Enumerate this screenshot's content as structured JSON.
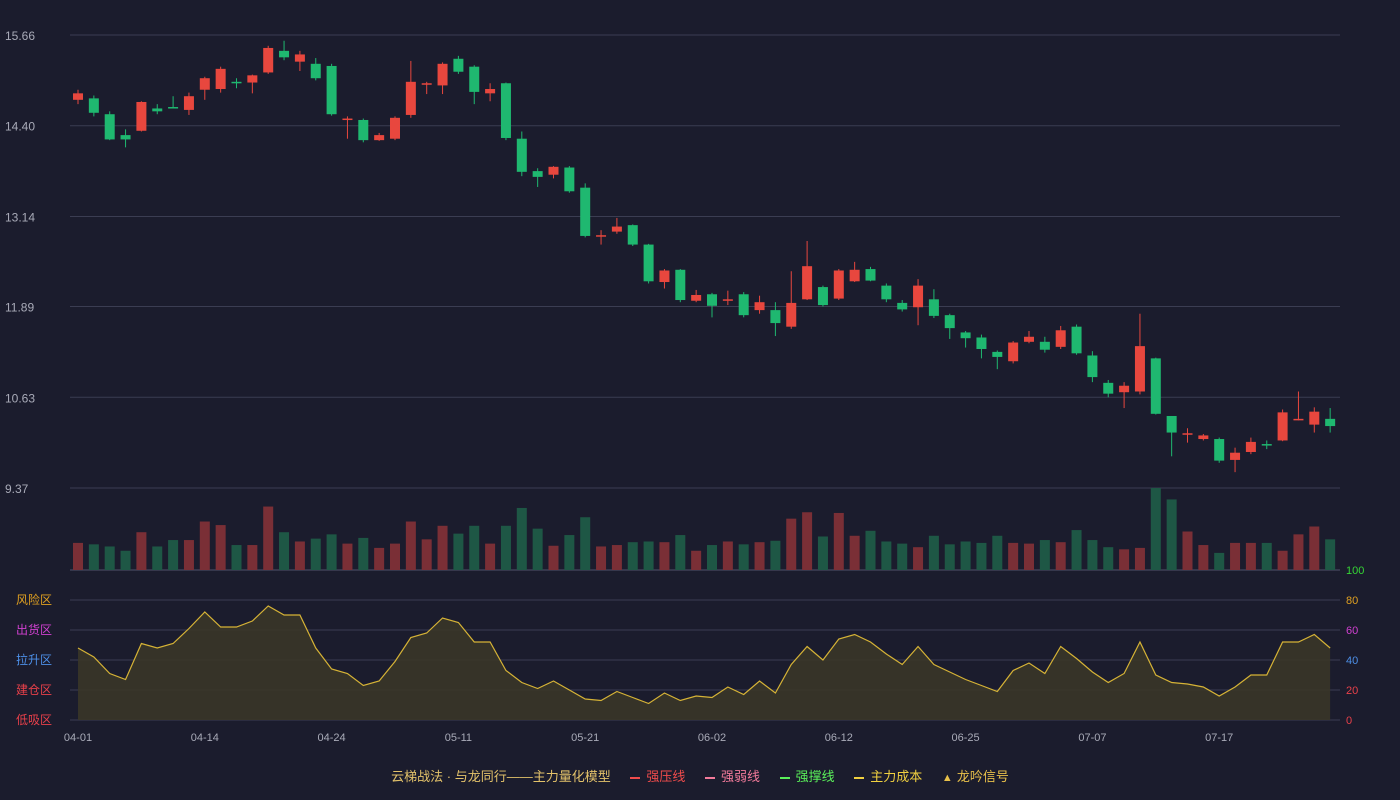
{
  "chart_data": {
    "type": "candlestick",
    "price_axis": {
      "ticks": [
        "15.66",
        "14.40",
        "13.14",
        "11.89",
        "10.63",
        "9.37"
      ],
      "range": [
        9.37,
        15.66
      ]
    },
    "oscillator_axis": {
      "right_ticks": [
        "100",
        "80",
        "60",
        "40",
        "20",
        "0"
      ],
      "right_tick_colors": [
        "#35d535",
        "#e0a020",
        "#d040d0",
        "#4d8fe8",
        "#e8404a",
        "#e8404a"
      ],
      "zones": [
        {
          "label": "风险区",
          "color": "#e0a020"
        },
        {
          "label": "出货区",
          "color": "#d040d0"
        },
        {
          "label": "拉升区",
          "color": "#4d8fe8"
        },
        {
          "label": "建仓区",
          "color": "#e8404a"
        },
        {
          "label": "低吸区",
          "color": "#e8404a"
        }
      ],
      "range": [
        0,
        100
      ]
    },
    "date_ticks": [
      {
        "i": 0,
        "label": "04-01"
      },
      {
        "i": 8,
        "label": "04-14"
      },
      {
        "i": 16,
        "label": "04-24"
      },
      {
        "i": 24,
        "label": "05-11"
      },
      {
        "i": 32,
        "label": "05-21"
      },
      {
        "i": 40,
        "label": "06-02"
      },
      {
        "i": 48,
        "label": "06-12"
      },
      {
        "i": 56,
        "label": "06-25"
      },
      {
        "i": 64,
        "label": "07-07"
      },
      {
        "i": 72,
        "label": "07-17"
      }
    ],
    "colors": {
      "up": "#e8473e",
      "down": "#1fb870",
      "vol_up": "#7a2f36",
      "vol_down": "#1e5745",
      "osc_line": "#d6b336",
      "osc_fill": "#3a3628"
    },
    "candles": [
      [
        14.76,
        14.85,
        14.9,
        14.7
      ],
      [
        14.78,
        14.58,
        14.82,
        14.53
      ],
      [
        14.56,
        14.21,
        14.6,
        14.2
      ],
      [
        14.27,
        14.21,
        14.35,
        14.1
      ],
      [
        14.33,
        14.73,
        14.74,
        14.32
      ],
      [
        14.64,
        14.6,
        14.7,
        14.56
      ],
      [
        14.66,
        14.65,
        14.81,
        14.64
      ],
      [
        14.62,
        14.81,
        14.86,
        14.55
      ],
      [
        14.9,
        15.06,
        15.08,
        14.76
      ],
      [
        14.91,
        15.19,
        15.22,
        14.86
      ],
      [
        15.01,
        14.99,
        15.06,
        14.92
      ],
      [
        15.0,
        15.1,
        15.11,
        14.85
      ],
      [
        15.14,
        15.48,
        15.51,
        15.12
      ],
      [
        15.44,
        15.35,
        15.58,
        15.31
      ],
      [
        15.29,
        15.39,
        15.44,
        15.16
      ],
      [
        15.26,
        15.06,
        15.34,
        15.03
      ],
      [
        15.23,
        14.56,
        15.26,
        14.54
      ],
      [
        14.48,
        14.5,
        14.53,
        14.22
      ],
      [
        14.48,
        14.2,
        14.5,
        14.17
      ],
      [
        14.2,
        14.27,
        14.3,
        14.19
      ],
      [
        14.22,
        14.51,
        14.53,
        14.2
      ],
      [
        14.55,
        15.01,
        15.3,
        14.51
      ],
      [
        14.98,
        14.99,
        15.01,
        14.84
      ],
      [
        14.96,
        15.26,
        15.28,
        14.84
      ],
      [
        15.33,
        15.15,
        15.37,
        15.12
      ],
      [
        15.22,
        14.87,
        15.24,
        14.7
      ],
      [
        14.85,
        14.91,
        14.99,
        14.74
      ],
      [
        14.99,
        14.23,
        15.0,
        14.2
      ],
      [
        14.22,
        13.76,
        14.32,
        13.7
      ],
      [
        13.77,
        13.69,
        13.81,
        13.55
      ],
      [
        13.72,
        13.83,
        13.84,
        13.67
      ],
      [
        13.82,
        13.49,
        13.84,
        13.47
      ],
      [
        13.54,
        12.87,
        13.6,
        12.85
      ],
      [
        12.87,
        12.88,
        12.95,
        12.75
      ],
      [
        12.93,
        13.0,
        13.12,
        12.9
      ],
      [
        13.02,
        12.75,
        13.03,
        12.73
      ],
      [
        12.75,
        12.24,
        12.76,
        12.21
      ],
      [
        12.23,
        12.39,
        12.41,
        12.14
      ],
      [
        12.4,
        11.98,
        12.41,
        11.95
      ],
      [
        11.97,
        12.05,
        12.12,
        11.95
      ],
      [
        12.06,
        11.9,
        12.08,
        11.74
      ],
      [
        11.98,
        11.99,
        12.11,
        11.91
      ],
      [
        12.06,
        11.77,
        12.09,
        11.74
      ],
      [
        11.84,
        11.95,
        12.04,
        11.79
      ],
      [
        11.84,
        11.66,
        11.95,
        11.48
      ],
      [
        11.61,
        11.94,
        12.38,
        11.58
      ],
      [
        11.99,
        12.45,
        12.8,
        11.98
      ],
      [
        12.16,
        11.91,
        12.18,
        11.89
      ],
      [
        12.0,
        12.39,
        12.41,
        11.98
      ],
      [
        12.24,
        12.4,
        12.51,
        12.23
      ],
      [
        12.41,
        12.25,
        12.44,
        12.24
      ],
      [
        12.18,
        11.99,
        12.21,
        11.95
      ],
      [
        11.94,
        11.85,
        11.98,
        11.82
      ],
      [
        11.88,
        12.18,
        12.27,
        11.63
      ],
      [
        11.99,
        11.76,
        12.13,
        11.73
      ],
      [
        11.77,
        11.59,
        11.79,
        11.44
      ],
      [
        11.53,
        11.45,
        11.55,
        11.32
      ],
      [
        11.46,
        11.3,
        11.5,
        11.17
      ],
      [
        11.26,
        11.19,
        11.28,
        11.02
      ],
      [
        11.13,
        11.39,
        11.41,
        11.1
      ],
      [
        11.4,
        11.47,
        11.55,
        11.38
      ],
      [
        11.4,
        11.29,
        11.47,
        11.25
      ],
      [
        11.33,
        11.56,
        11.62,
        11.3
      ],
      [
        11.61,
        11.24,
        11.64,
        11.22
      ],
      [
        11.21,
        10.91,
        11.27,
        10.84
      ],
      [
        10.83,
        10.68,
        10.87,
        10.63
      ],
      [
        10.7,
        10.79,
        10.84,
        10.48
      ],
      [
        10.71,
        11.34,
        11.79,
        10.67
      ],
      [
        11.17,
        10.4,
        11.18,
        10.39
      ],
      [
        10.37,
        10.14,
        10.37,
        9.81
      ],
      [
        10.12,
        10.13,
        10.2,
        10.0
      ],
      [
        10.05,
        10.1,
        10.12,
        10.03
      ],
      [
        10.05,
        9.75,
        10.07,
        9.72
      ],
      [
        9.76,
        9.86,
        9.93,
        9.59
      ],
      [
        9.87,
        10.01,
        10.07,
        9.84
      ],
      [
        9.98,
        9.97,
        10.03,
        9.91
      ],
      [
        10.03,
        10.42,
        10.46,
        10.02
      ],
      [
        10.32,
        10.33,
        10.71,
        10.31
      ],
      [
        10.25,
        10.43,
        10.49,
        10.14
      ],
      [
        10.33,
        10.23,
        10.48,
        10.14
      ]
    ],
    "volume": [
      38,
      36,
      33,
      27,
      53,
      33,
      42,
      42,
      68,
      63,
      35,
      35,
      89,
      53,
      40,
      44,
      50,
      37,
      45,
      31,
      37,
      68,
      43,
      62,
      51,
      62,
      37,
      62,
      87,
      58,
      34,
      49,
      74,
      33,
      35,
      39,
      40,
      39,
      49,
      27,
      35,
      40,
      36,
      39,
      41,
      72,
      81,
      47,
      80,
      48,
      55,
      40,
      37,
      32,
      48,
      36,
      40,
      38,
      48,
      38,
      37,
      42,
      39,
      56,
      42,
      32,
      29,
      31,
      115,
      99,
      54,
      35,
      24,
      38,
      38,
      38,
      27,
      50,
      61,
      43
    ],
    "oscillator": [
      48,
      42,
      31,
      27,
      51,
      48,
      51,
      61,
      72,
      62,
      62,
      66,
      76,
      70,
      70,
      48,
      34,
      31,
      23,
      26,
      39,
      55,
      58,
      68,
      65,
      52,
      52,
      33,
      25,
      21,
      26,
      20,
      14,
      13,
      19,
      15,
      11,
      18,
      13,
      16,
      15,
      22,
      17,
      26,
      18,
      37,
      49,
      40,
      54,
      57,
      52,
      44,
      37,
      49,
      37,
      32,
      27,
      23,
      19,
      33,
      38,
      31,
      49,
      41,
      32,
      25,
      31,
      52,
      30,
      25,
      24,
      22,
      16,
      22,
      30,
      30,
      52,
      52,
      57,
      48
    ]
  },
  "legend": {
    "title": "云梯战法 · 与龙同行——主力量化模型",
    "items": [
      {
        "label": "强压线",
        "color": "#f04c4c",
        "style": "solid"
      },
      {
        "label": "强弱线",
        "color": "#f27a9a",
        "style": "dash"
      },
      {
        "label": "强撑线",
        "color": "#5af05a",
        "style": "solid"
      },
      {
        "label": "主力成本",
        "color": "#f0d040",
        "style": "dash"
      },
      {
        "label": "龙吟信号",
        "color": "#e8c04a",
        "style": "triangle",
        "icon": "triangle-icon"
      }
    ]
  }
}
